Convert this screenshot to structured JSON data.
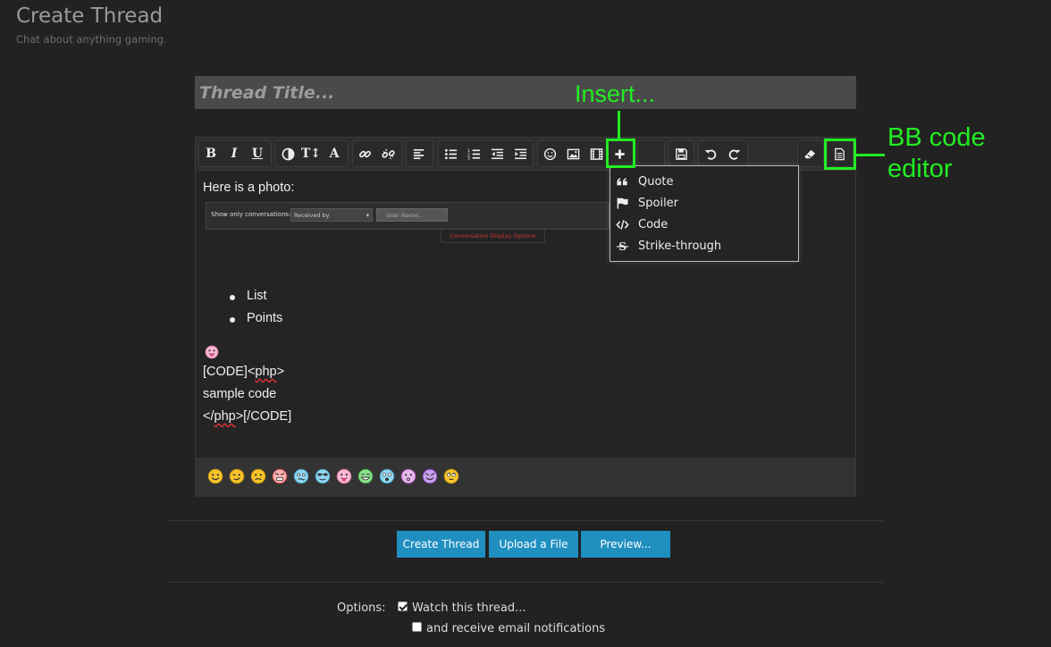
{
  "page": {
    "title": "Create Thread",
    "description": "Chat about anything gaming."
  },
  "thread_title": {
    "placeholder": "Thread Title..."
  },
  "editor": {
    "lines": {
      "intro": "Here is a photo:",
      "list_1": "List",
      "list_2": "Points",
      "code_open_a": "[CODE]<",
      "code_open_b": "php",
      "code_open_c": ">",
      "code_body": "sample code",
      "code_close_a": "</",
      "code_close_b": "php",
      "code_close_c": ">[/CODE]"
    },
    "embedded_image": {
      "label": "Show only conversations:",
      "select": "Received by",
      "search": "User Name...",
      "tab": "Conversation Display Options"
    }
  },
  "insert_menu": {
    "items": [
      {
        "label": "Quote",
        "icon": "quote-icon"
      },
      {
        "label": "Spoiler",
        "icon": "flag-icon"
      },
      {
        "label": "Code",
        "icon": "code-icon"
      },
      {
        "label": "Strike-through",
        "icon": "strikethrough-icon"
      }
    ]
  },
  "annotations": {
    "insert": "Insert...",
    "bb_line1": "BB code",
    "bb_line2": "editor"
  },
  "buttons": {
    "create": "Create Thread",
    "upload": "Upload a File",
    "preview": "Preview..."
  },
  "options": {
    "label": "Options:",
    "watch": "Watch this thread...",
    "email": "and receive email notifications",
    "watch_checked": true,
    "email_checked": false
  },
  "colors": {
    "accent": "#1f8fc0",
    "annotation": "#22ee22"
  }
}
